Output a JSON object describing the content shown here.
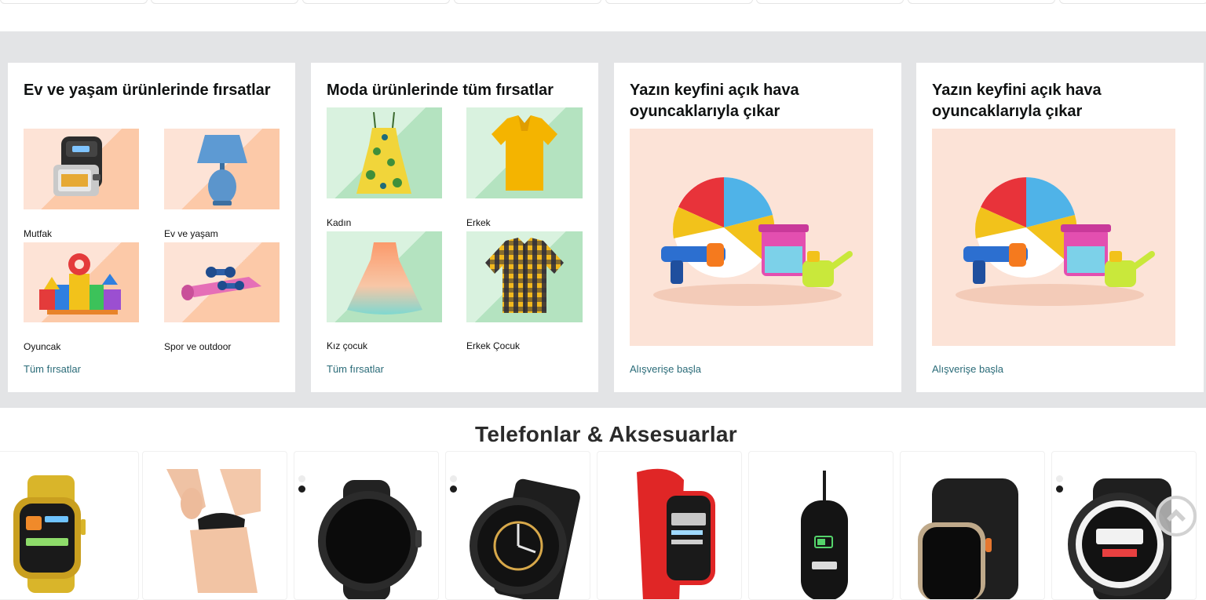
{
  "deals": [
    {
      "title": "Ev ve yaşam ürünlerinde fırsatlar",
      "tiles": [
        {
          "label": "Mutfak",
          "icon": "air-fryer-icon"
        },
        {
          "label": "Ev ve yaşam",
          "icon": "lamp-icon"
        },
        {
          "label": "Oyuncak",
          "icon": "toy-blocks-icon"
        },
        {
          "label": "Spor ve outdoor",
          "icon": "yoga-mat-icon"
        }
      ],
      "link": "Tüm fırsatlar"
    },
    {
      "title": "Moda ürünlerinde tüm fırsatlar",
      "tiles": [
        {
          "label": "Kadın",
          "icon": "floral-dress-icon"
        },
        {
          "label": "Erkek",
          "icon": "yellow-polo-shirt-icon"
        },
        {
          "label": "Kız çocuk",
          "icon": "girls-dress-icon"
        },
        {
          "label": "Erkek Çocuk",
          "icon": "plaid-shirt-icon"
        }
      ],
      "link": "Tüm fırsatlar"
    },
    {
      "title": "Yazın keyfini açık hava oyuncaklarıyla çıkar",
      "image": "beach-toys-icon",
      "link": "Alışverişe başla"
    },
    {
      "title": "Yazın keyfini açık hava oyuncaklarıyla çıkar",
      "image": "beach-toys-icon",
      "link": "Alışverişe başla"
    }
  ],
  "section": {
    "title": "Telefonlar & Aksesuarlar"
  },
  "products": [
    {
      "icon": "gold-smartwatch-icon"
    },
    {
      "icon": "wrist-strap-icon"
    },
    {
      "icon": "round-smartwatch-icon"
    },
    {
      "icon": "rugged-smartwatch-icon"
    },
    {
      "icon": "red-fitness-band-icon"
    },
    {
      "icon": "fitness-tracker-charging-icon"
    },
    {
      "icon": "ultra-smartwatch-icon"
    },
    {
      "icon": "sport-smartwatch-icon"
    }
  ],
  "colors": {
    "band": "#e3e4e6",
    "link": "#2a6b78",
    "title": "#0f1111"
  }
}
